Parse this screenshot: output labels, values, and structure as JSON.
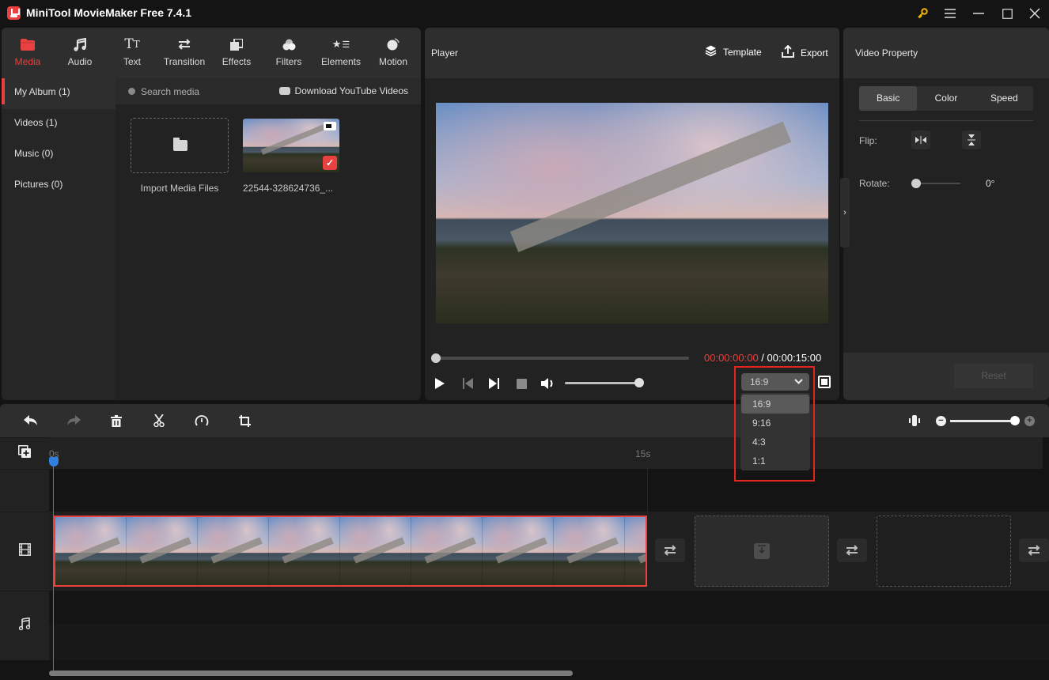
{
  "titlebar": {
    "title": "MiniTool MovieMaker Free 7.4.1",
    "icons": [
      "key-icon",
      "menu-icon",
      "minimize-icon",
      "maximize-icon",
      "close-icon"
    ]
  },
  "toolbar": {
    "tabs": [
      {
        "label": "Media",
        "icon": "folder-icon",
        "active": true
      },
      {
        "label": "Audio",
        "icon": "music-icon"
      },
      {
        "label": "Text",
        "icon": "text-icon"
      },
      {
        "label": "Transition",
        "icon": "transition-icon"
      },
      {
        "label": "Effects",
        "icon": "effects-icon"
      },
      {
        "label": "Filters",
        "icon": "filters-icon"
      },
      {
        "label": "Elements",
        "icon": "elements-icon"
      },
      {
        "label": "Motion",
        "icon": "motion-icon"
      }
    ]
  },
  "album": {
    "items": [
      {
        "label": "My Album (1)",
        "active": true
      },
      {
        "label": "Videos (1)"
      },
      {
        "label": "Music (0)"
      },
      {
        "label": "Pictures (0)"
      }
    ]
  },
  "media": {
    "search_placeholder": "Search media",
    "download_label": "Download YouTube Videos",
    "import_label": "Import Media Files",
    "clip_name": "22544-328624736_..."
  },
  "player": {
    "title": "Player",
    "template_label": "Template",
    "export_label": "Export",
    "current_time": "00:00:00:00",
    "separator": " / ",
    "total_time": "00:00:15:00",
    "progress": 0,
    "volume": 1.0,
    "aspect_ratio": "16:9",
    "aspect_options": [
      "16:9",
      "9:16",
      "4:3",
      "1:1"
    ],
    "chevron": "⌄"
  },
  "property": {
    "title": "Video Property",
    "tabs": [
      "Basic",
      "Color",
      "Speed"
    ],
    "active_tab": "Basic",
    "flip_label": "Flip:",
    "rotate_label": "Rotate:",
    "rotate_value": "0°",
    "reset_label": "Reset"
  },
  "timeline": {
    "ruler": [
      "0s",
      "15s"
    ],
    "zoom_level": 1.0,
    "colors": {
      "accent": "#e8413f",
      "playhead": "#2f7fe0"
    }
  }
}
